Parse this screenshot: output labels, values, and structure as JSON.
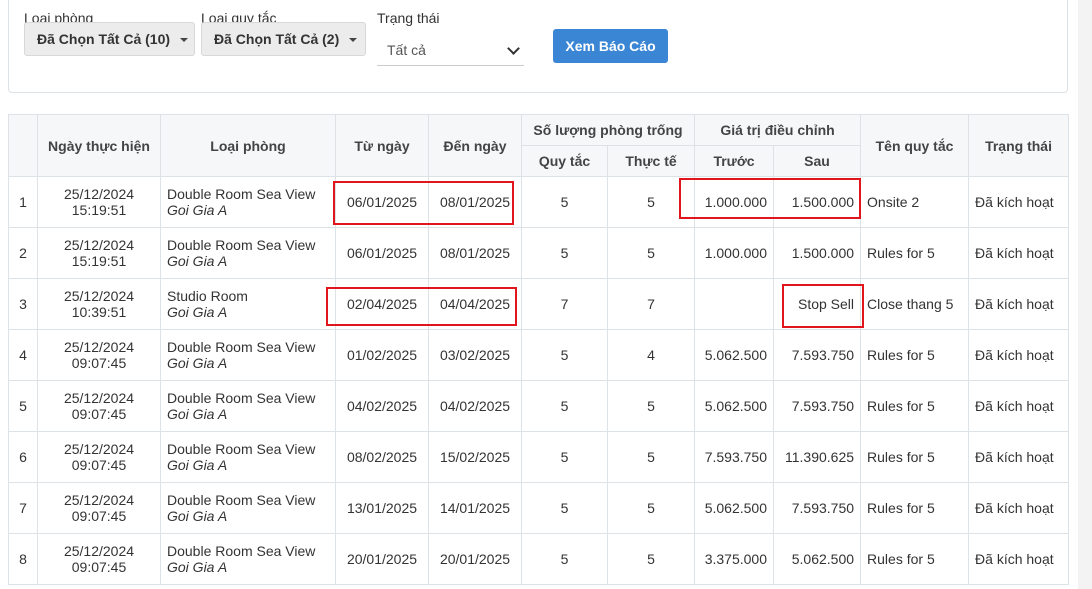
{
  "filters": {
    "room_type": {
      "label": "Loại phòng",
      "value": "Đã Chọn Tất Cả (10)"
    },
    "rule_type": {
      "label": "Loại quy tắc",
      "value": "Đã Chọn Tất Cả (2)"
    },
    "status": {
      "label": "Trạng thái",
      "value": "Tất cả"
    },
    "view_button": "Xem Báo Cáo"
  },
  "table": {
    "headers": {
      "date": "Ngày thực hiện",
      "room": "Loại phòng",
      "from": "Từ ngày",
      "to": "Đến ngày",
      "vacancy": "Số lượng phòng trống",
      "vacancy_rule": "Quy tắc",
      "vacancy_actual": "Thực tế",
      "adjust": "Giá trị điều chỉnh",
      "adjust_before": "Trước",
      "adjust_after": "Sau",
      "rule_name": "Tên quy tắc",
      "status": "Trạng thái"
    },
    "rows": [
      {
        "no": "1",
        "date": "25/12/2024",
        "time": "15:19:51",
        "room": "Double Room Sea View",
        "plan": "Goi Gia A",
        "from": "06/01/2025",
        "to": "08/01/2025",
        "rule": "5",
        "actual": "5",
        "before": "1.000.000",
        "after": "1.500.000",
        "rule_name": "Onsite 2",
        "status": "Đã kích hoạt"
      },
      {
        "no": "2",
        "date": "25/12/2024",
        "time": "15:19:51",
        "room": "Double Room Sea View",
        "plan": "Goi Gia A",
        "from": "06/01/2025",
        "to": "08/01/2025",
        "rule": "5",
        "actual": "5",
        "before": "1.000.000",
        "after": "1.500.000",
        "rule_name": "Rules for 5",
        "status": "Đã kích hoạt"
      },
      {
        "no": "3",
        "date": "25/12/2024",
        "time": "10:39:51",
        "room": "Studio Room",
        "plan": "Goi Gia A",
        "from": "02/04/2025",
        "to": "04/04/2025",
        "rule": "7",
        "actual": "7",
        "before": "",
        "after": "Stop Sell",
        "rule_name": "Close thang 5",
        "status": "Đã kích hoạt"
      },
      {
        "no": "4",
        "date": "25/12/2024",
        "time": "09:07:45",
        "room": "Double Room Sea View",
        "plan": "Goi Gia A",
        "from": "01/02/2025",
        "to": "03/02/2025",
        "rule": "5",
        "actual": "4",
        "before": "5.062.500",
        "after": "7.593.750",
        "rule_name": "Rules for 5",
        "status": "Đã kích hoạt"
      },
      {
        "no": "5",
        "date": "25/12/2024",
        "time": "09:07:45",
        "room": "Double Room Sea View",
        "plan": "Goi Gia A",
        "from": "04/02/2025",
        "to": "04/02/2025",
        "rule": "5",
        "actual": "5",
        "before": "5.062.500",
        "after": "7.593.750",
        "rule_name": "Rules for 5",
        "status": "Đã kích hoạt"
      },
      {
        "no": "6",
        "date": "25/12/2024",
        "time": "09:07:45",
        "room": "Double Room Sea View",
        "plan": "Goi Gia A",
        "from": "08/02/2025",
        "to": "15/02/2025",
        "rule": "5",
        "actual": "5",
        "before": "7.593.750",
        "after": "11.390.625",
        "rule_name": "Rules for 5",
        "status": "Đã kích hoạt"
      },
      {
        "no": "7",
        "date": "25/12/2024",
        "time": "09:07:45",
        "room": "Double Room Sea View",
        "plan": "Goi Gia A",
        "from": "13/01/2025",
        "to": "14/01/2025",
        "rule": "5",
        "actual": "5",
        "before": "5.062.500",
        "after": "7.593.750",
        "rule_name": "Rules for 5",
        "status": "Đã kích hoạt"
      },
      {
        "no": "8",
        "date": "25/12/2024",
        "time": "09:07:45",
        "room": "Double Room Sea View",
        "plan": "Goi Gia A",
        "from": "20/01/2025",
        "to": "20/01/2025",
        "rule": "5",
        "actual": "5",
        "before": "3.375.000",
        "after": "5.062.500",
        "rule_name": "Rules for 5",
        "status": "Đã kích hoạt"
      }
    ]
  },
  "colors": {
    "primary_button": "#3a86d4",
    "highlight": "#e0161c"
  }
}
